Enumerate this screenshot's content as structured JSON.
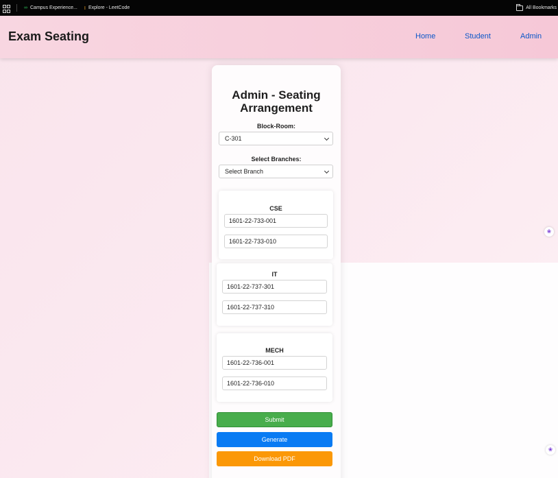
{
  "bookmarks_bar": {
    "items": [
      {
        "label": "Campus Experience...",
        "icon": "infinity-icon"
      },
      {
        "label": "Explore - LeetCode",
        "icon": "leetcode-icon"
      }
    ],
    "all_bookmarks_label": "All Bookmarks"
  },
  "header": {
    "title": "Exam Seating",
    "nav": [
      "Home",
      "Student",
      "Admin"
    ]
  },
  "card": {
    "title_line1": "Admin - Seating",
    "title_line2": "Arrangement",
    "block_room_label": "Block-Room:",
    "block_room_value": "C-301",
    "branches_label": "Select Branches:",
    "branches_value": "Select Branch",
    "branches": [
      {
        "name": "CSE",
        "from": "1601-22-733-001",
        "to": "1601-22-733-010"
      },
      {
        "name": "IT",
        "from": "1601-22-737-301",
        "to": "1601-22-737-310"
      },
      {
        "name": "MECH",
        "from": "1601-22-736-001",
        "to": "1601-22-736-010"
      }
    ]
  },
  "buttons": {
    "submit": "Submit",
    "generate": "Generate",
    "download": "Download PDF"
  },
  "colors": {
    "submit": "#48ad4c",
    "generate": "#0a7bf3",
    "download": "#fb9807",
    "nav_link": "#0a56c8"
  }
}
